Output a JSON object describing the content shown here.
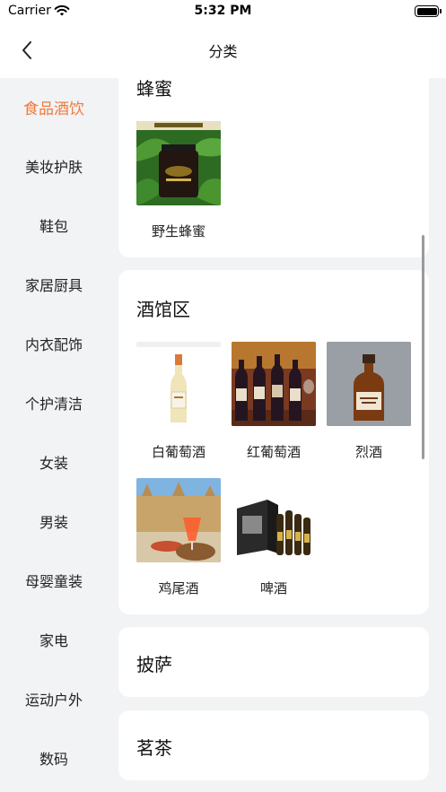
{
  "status_bar": {
    "carrier": "Carrier",
    "time": "5:32 PM"
  },
  "nav": {
    "title": "分类"
  },
  "sidebar": {
    "items": [
      {
        "label": "食品酒饮",
        "active": true
      },
      {
        "label": "美妆护肤"
      },
      {
        "label": "鞋包"
      },
      {
        "label": "家居厨具"
      },
      {
        "label": "内衣配饰"
      },
      {
        "label": "个护清洁"
      },
      {
        "label": "女装"
      },
      {
        "label": "男装"
      },
      {
        "label": "母婴童装"
      },
      {
        "label": "家电"
      },
      {
        "label": "运动户外"
      },
      {
        "label": "数码"
      }
    ]
  },
  "sections": [
    {
      "title": "蜂蜜",
      "products": [
        {
          "name": "野生蜂蜜",
          "image": "honey-jar"
        }
      ]
    },
    {
      "title": "酒馆区",
      "products": [
        {
          "name": "白葡萄酒",
          "image": "white-wine-bottle"
        },
        {
          "name": "红葡萄酒",
          "image": "red-wine-bottles"
        },
        {
          "name": "烈酒",
          "image": "spirits-bottle"
        },
        {
          "name": "鸡尾酒",
          "image": "cocktail-glass"
        },
        {
          "name": "啤酒",
          "image": "beer-pack"
        }
      ]
    },
    {
      "title": "披萨",
      "products": []
    },
    {
      "title": "茗茶",
      "products": []
    }
  ],
  "colors": {
    "accent": "#f07a3a",
    "background": "#f2f3f5",
    "card": "#ffffff"
  }
}
